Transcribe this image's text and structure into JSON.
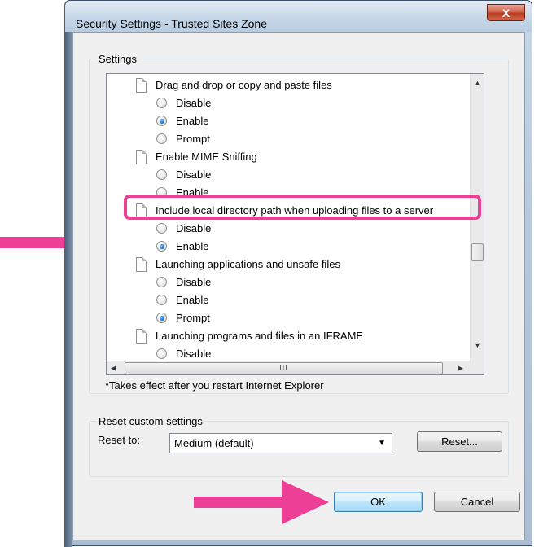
{
  "window": {
    "title": "Security Settings - Trusted Sites Zone",
    "close_glyph": "X"
  },
  "settings": {
    "group_label": "Settings",
    "rows": [
      {
        "kind": "header",
        "label": "Drag and drop or copy and paste files"
      },
      {
        "kind": "radio",
        "label": "Disable",
        "checked": false
      },
      {
        "kind": "radio",
        "label": "Enable",
        "checked": true
      },
      {
        "kind": "radio",
        "label": "Prompt",
        "checked": false
      },
      {
        "kind": "header",
        "label": "Enable MIME Sniffing"
      },
      {
        "kind": "radio",
        "label": "Disable",
        "checked": false
      },
      {
        "kind": "radio",
        "label": "Enable",
        "checked": false
      },
      {
        "kind": "header",
        "label": "Include local directory path when uploading files to a server"
      },
      {
        "kind": "radio",
        "label": "Disable",
        "checked": false
      },
      {
        "kind": "radio",
        "label": "Enable",
        "checked": true
      },
      {
        "kind": "header",
        "label": "Launching applications and unsafe files"
      },
      {
        "kind": "radio",
        "label": "Disable",
        "checked": false
      },
      {
        "kind": "radio",
        "label": "Enable",
        "checked": false
      },
      {
        "kind": "radio",
        "label": "Prompt",
        "checked": true
      },
      {
        "kind": "header",
        "label": "Launching programs and files in an IFRAME"
      },
      {
        "kind": "radio",
        "label": "Disable",
        "checked": false
      }
    ],
    "hscroll_grip": "III",
    "note": "*Takes effect after you restart Internet Explorer"
  },
  "reset": {
    "group_label": "Reset custom settings",
    "reset_to_label": "Reset to:",
    "combo_value": "Medium (default)",
    "reset_button": "Reset..."
  },
  "footer": {
    "ok_label": "OK",
    "cancel_label": "Cancel"
  },
  "colors": {
    "highlight": "#ee3f96",
    "selection_dot": "#1f6fc4"
  }
}
